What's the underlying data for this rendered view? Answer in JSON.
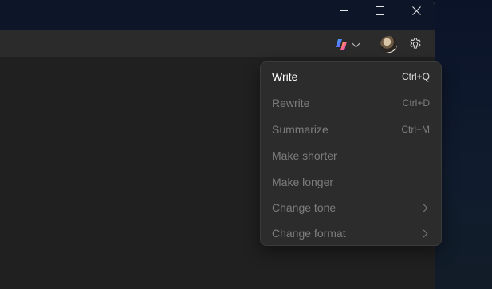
{
  "window": {
    "controls": {
      "minimize_icon": "minimize-icon",
      "maximize_icon": "maximize-icon",
      "close_icon": "close-icon"
    }
  },
  "toolbar": {
    "copilot_icon": "copilot-icon",
    "copilot_dropdown_icon": "chevron-down-icon",
    "avatar": "user-avatar",
    "settings_icon": "gear-icon"
  },
  "menu": {
    "items": [
      {
        "label": "Write",
        "shortcut": "Ctrl+Q",
        "enabled": true
      },
      {
        "label": "Rewrite",
        "shortcut": "Ctrl+D",
        "enabled": false
      },
      {
        "label": "Summarize",
        "shortcut": "Ctrl+M",
        "enabled": false
      },
      {
        "label": "Make shorter",
        "shortcut": "",
        "enabled": false
      },
      {
        "label": "Make longer",
        "shortcut": "",
        "enabled": false
      },
      {
        "label": "Change tone",
        "shortcut": "",
        "enabled": false,
        "submenu": true
      },
      {
        "label": "Change format",
        "shortcut": "",
        "enabled": false,
        "submenu": true
      }
    ]
  },
  "colors": {
    "window_bg": "#202020",
    "toolbar_bg": "#2b2b2b",
    "titlebar_bg": "#0d1528",
    "menu_bg": "#2c2c2c",
    "text_active": "#ffffff",
    "text_disabled": "#7d7d7d"
  }
}
